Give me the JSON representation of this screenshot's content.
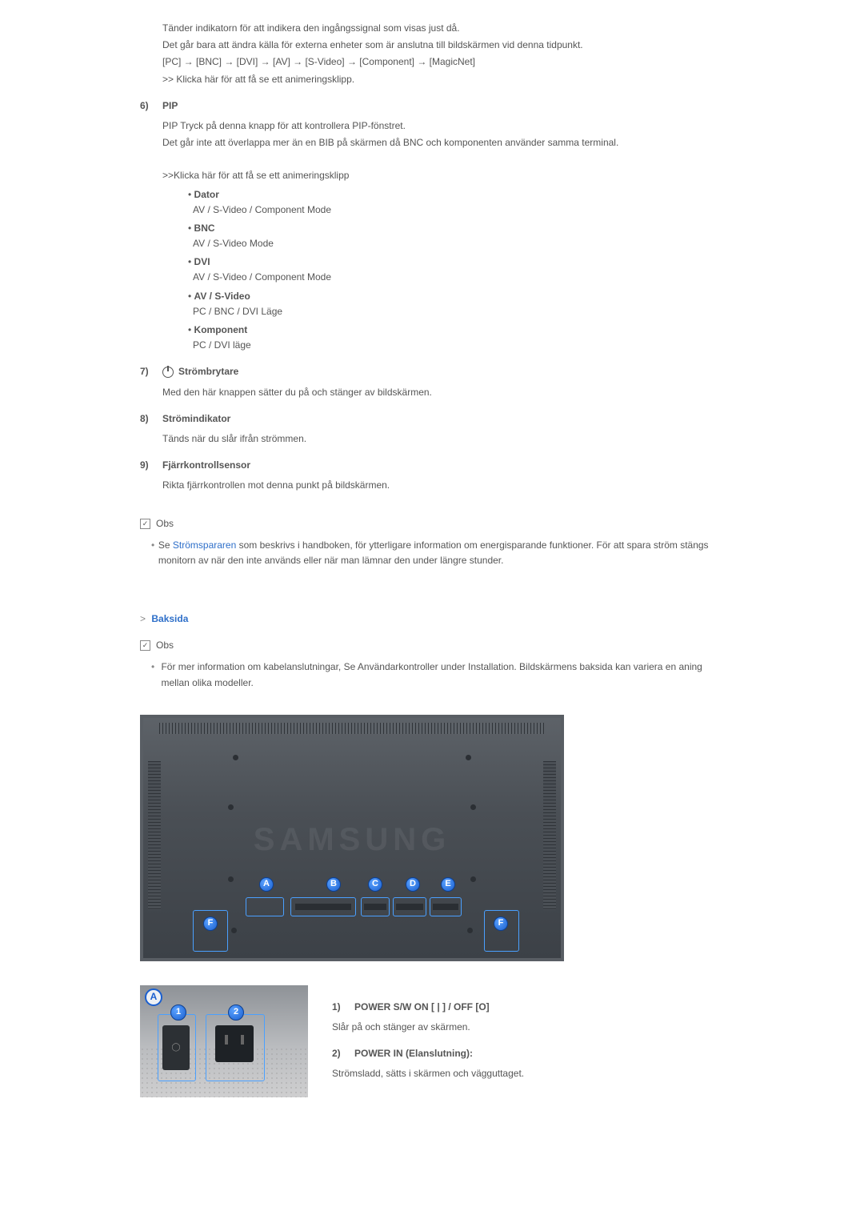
{
  "intro": {
    "p1": "Tänder indikatorn för att indikera den ingångssignal som visas just då.",
    "p2": "Det går bara att ändra källa för externa enheter som är anslutna till bildskärmen vid denna tidpunkt.",
    "p3": "[PC] → [BNC] → [DVI] → [AV] → [S-Video] → [Component] → [MagicNet]",
    "p4": ">> Klicka här för att få se ett animeringsklipp."
  },
  "sections": {
    "pip": {
      "num": "6)",
      "title": "PIP",
      "p1": "PIP Tryck på denna knapp för att kontrollera PIP-fönstret.",
      "p2": "Det går inte att överlappa mer än en BIB på skärmen då BNC och komponenten använder samma terminal.",
      "p3": ">>Klicka här för att få se ett animeringsklipp",
      "bullets": [
        {
          "label": "Dator",
          "sub": "AV / S-Video / Component Mode"
        },
        {
          "label": "BNC",
          "sub": "AV / S-Video Mode"
        },
        {
          "label": "DVI",
          "sub": "AV / S-Video / Component Mode"
        },
        {
          "label": "AV / S-Video",
          "sub": "PC / BNC / DVI Läge"
        },
        {
          "label": "Komponent",
          "sub": "PC / DVI läge"
        }
      ]
    },
    "power": {
      "num": "7)",
      "title": "Strömbrytare",
      "p1": "Med den här knappen sätter du på och stänger av bildskärmen."
    },
    "indicator": {
      "num": "8)",
      "title": "Strömindikator",
      "p1": "Tänds när du slår ifrån strömmen."
    },
    "remote": {
      "num": "9)",
      "title": "Fjärrkontrollsensor",
      "p1": "Rikta fjärrkontrollen mot denna punkt på bildskärmen."
    }
  },
  "obs1": {
    "label": "Obs",
    "text_pre": "Se ",
    "link": "Strömspararen",
    "text_post": " som beskrivs i handboken, för ytterligare information om energisparande funktioner. För att spara ström stängs monitorn av när den inte används eller när man lämnar den under längre stunder."
  },
  "baksida": {
    "header": "Baksida",
    "arrow": ">"
  },
  "obs2": {
    "label": "Obs",
    "text": "För mer information om kabelanslutningar, Se Användarkontroller under Installation. Bildskärmens baksida kan variera en aning mellan olika modeller."
  },
  "rear": {
    "logo": "SAMSUNG",
    "ports": [
      "A",
      "B",
      "C",
      "D",
      "E",
      "F",
      "F"
    ]
  },
  "sub": {
    "badge": "A",
    "n1": "1",
    "n2": "2",
    "rows": [
      {
        "num": "1)",
        "title": "POWER S/W ON [ | ] / OFF [O]",
        "desc": "Slår på och stänger av skärmen."
      },
      {
        "num": "2)",
        "title": "POWER IN (Elanslutning):",
        "desc": "Strömsladd, sätts i skärmen och vägguttaget."
      }
    ]
  }
}
